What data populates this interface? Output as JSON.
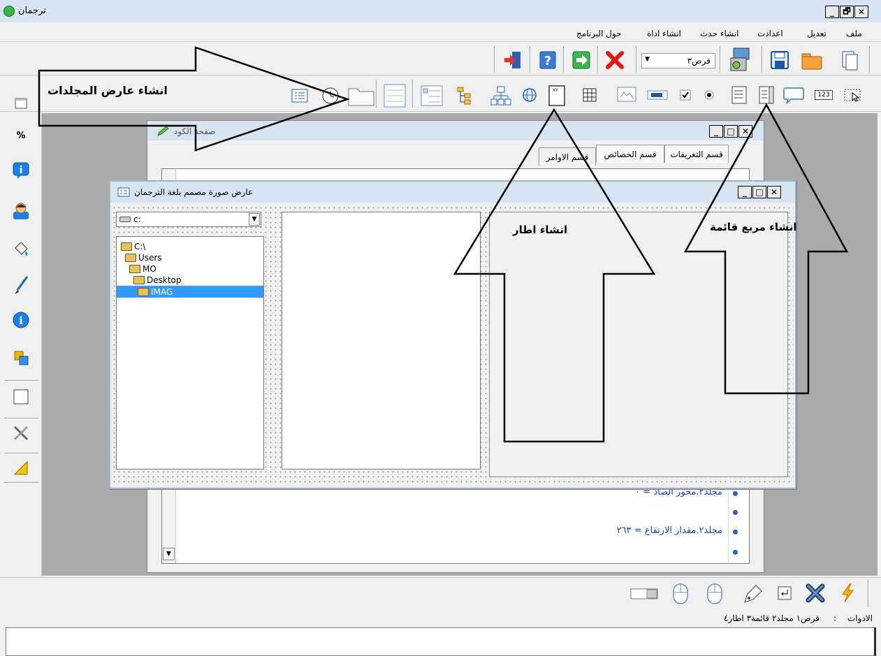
{
  "app": {
    "title": "ترجمان",
    "window_controls": {
      "minimize": "_",
      "maximize": "🗗",
      "close": "✕"
    }
  },
  "menu": {
    "items": [
      "ملف",
      "تعديل",
      "اعدادت",
      "انشاء حدث",
      "انشاء اداة",
      "حول البرنامج"
    ]
  },
  "toolbar": {
    "drive_select": "قرص٣"
  },
  "annotations": {
    "folder_viewer": "انشاء عارض المجلدات",
    "frame": "انشاء اطار",
    "list_box": "انشاء مربع قائمة"
  },
  "code_window": {
    "title": "صفحة الكود",
    "tabs": [
      "قسم التعريفات",
      "قسم الخصائص",
      "قسم الاوامر"
    ],
    "lines": [
      "مجلد٢.محور الصاد = ٠",
      "",
      "مجلد٢.مقدار الارتفاع = ٢٦٣",
      ""
    ]
  },
  "designer_window": {
    "title": "عارض صورة مصمم بلغة الترجمان",
    "drive_value": "c:",
    "tree": [
      "C:\\",
      "Users",
      "MO",
      "Desktop",
      "IMAG"
    ],
    "selected_folder": "IMAG"
  },
  "status": {
    "label": "الادوات",
    "separator": ":",
    "value": "قرص١ مجلد٢ قائمة٣ اطار٤"
  },
  "colors": {
    "titlebar": "#d7e4f2",
    "selection": "#3399ff",
    "code_text": "#1f3fbf",
    "workspace": "#aaaaaa"
  },
  "icons": {
    "toolbar_top": [
      "new-file-icon",
      "open-folder-icon",
      "save-icon",
      "computer-icon",
      "stop-icon",
      "run-icon",
      "help-icon",
      "exit-icon"
    ],
    "toolbar_mid": [
      "select-icon",
      "number-icon",
      "speech-bubble-icon",
      "listbox-icon",
      "combobox-icon",
      "radio-icon",
      "checkbox-icon",
      "progress-icon",
      "image-icon",
      "grid-icon",
      "frame-icon",
      "globe-icon",
      "network-icon",
      "tree-icon",
      "list-icon",
      "file-list-icon",
      "folder-viewer-icon",
      "clock-icon",
      "detail-icon"
    ],
    "toolbar_left": [
      "window-icon",
      "percent-icon",
      "info-box-icon",
      "user-icon",
      "paint-bucket-icon",
      "brush-icon",
      "info-icon",
      "layers-icon",
      "rectangle-icon",
      "tools-icon",
      "ruler-icon"
    ],
    "toolbar_bottom": [
      "lightning-icon",
      "delete-icon",
      "enter-icon",
      "pen-icon",
      "mouse-icon",
      "mouse-right-icon",
      "toggle-icon"
    ]
  }
}
